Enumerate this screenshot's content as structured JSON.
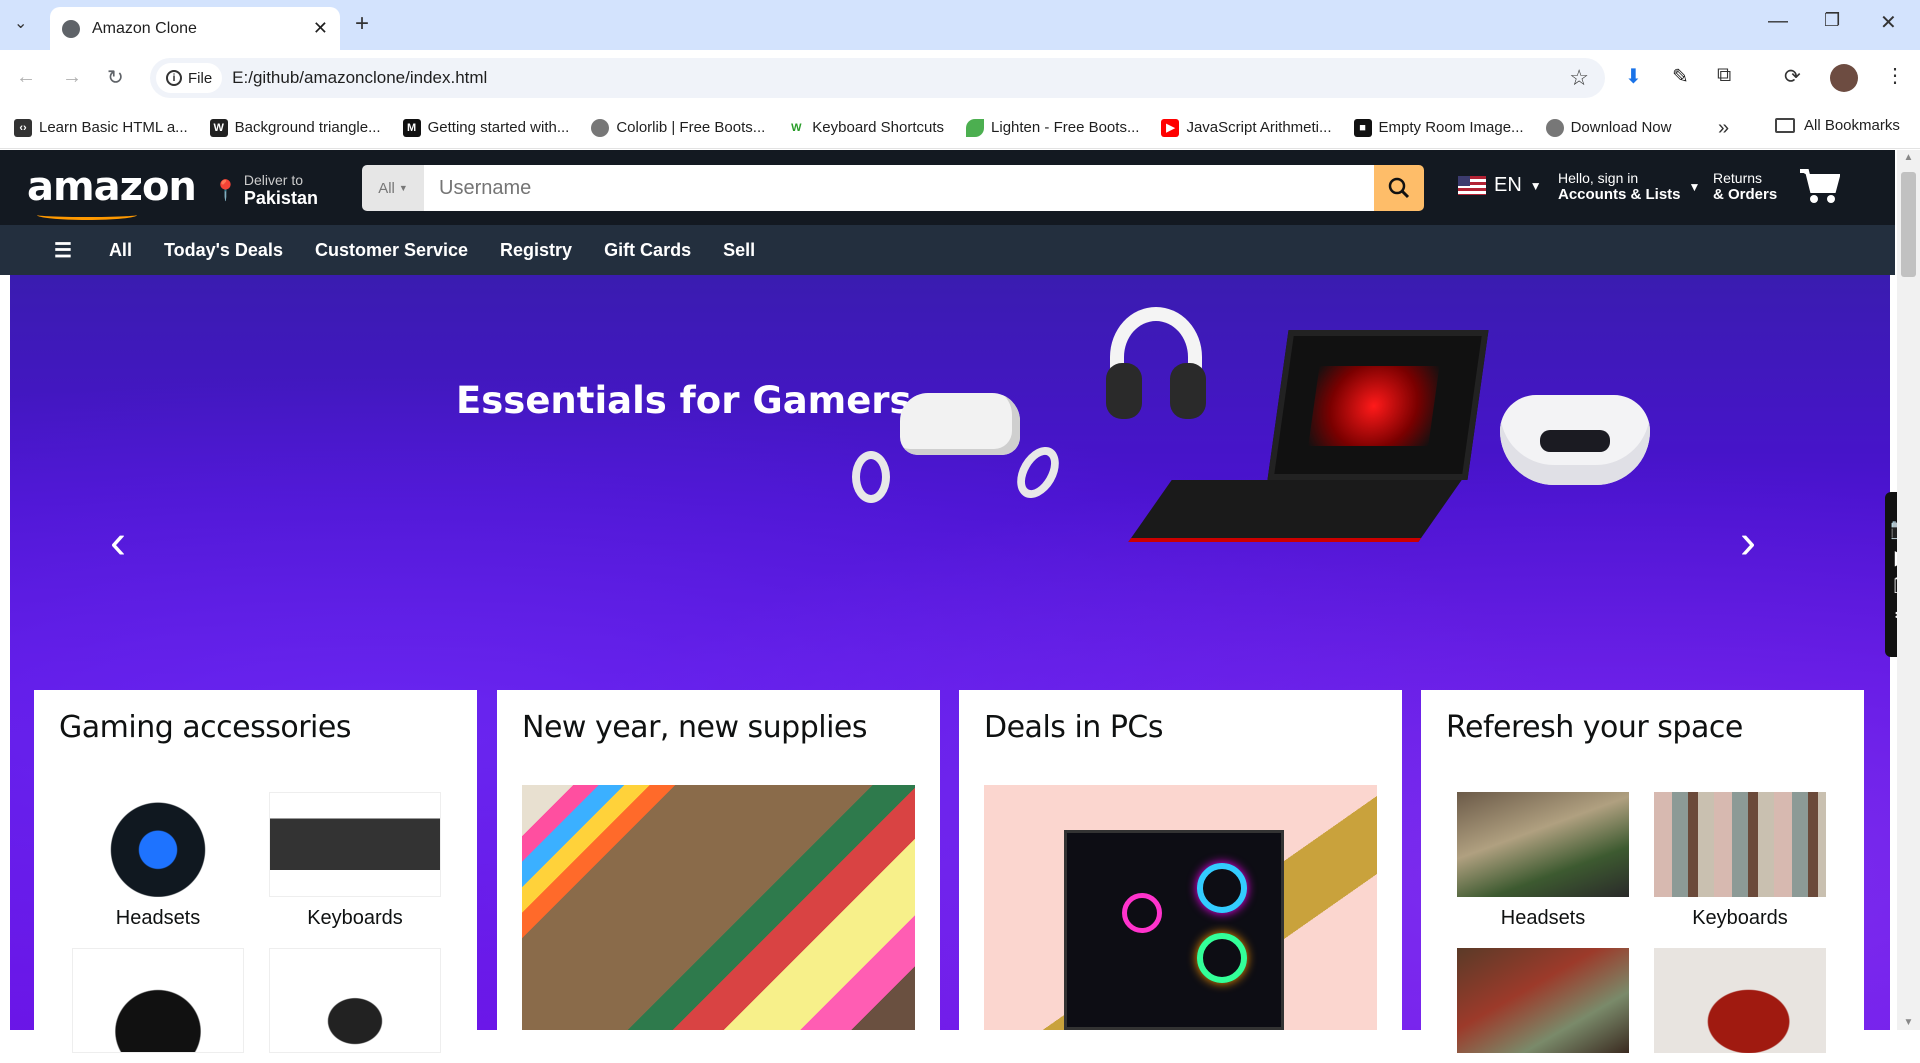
{
  "browser": {
    "tab_title": "Amazon Clone",
    "address_scheme": "File",
    "address_url": "E:/github/amazonclone/index.html",
    "bookmarks": [
      {
        "label": "Learn Basic HTML a...",
        "icon": "code-icon"
      },
      {
        "label": "Background triangle...",
        "icon": "w-icon"
      },
      {
        "label": "Getting started with...",
        "icon": "m-icon"
      },
      {
        "label": "Colorlib | Free Boots...",
        "icon": "globe-icon"
      },
      {
        "label": "Keyboard Shortcuts",
        "icon": "w-icon"
      },
      {
        "label": "Lighten - Free Boots...",
        "icon": "leaf-icon"
      },
      {
        "label": "JavaScript Arithmeti...",
        "icon": "youtube-icon"
      },
      {
        "label": "Empty Room Image...",
        "icon": "square-icon"
      },
      {
        "label": "Download Now",
        "icon": "globe-icon"
      }
    ],
    "all_bookmarks": "All Bookmarks"
  },
  "header": {
    "logo": "amazon",
    "deliver_line1": "Deliver to",
    "deliver_line2": "Pakistan",
    "search_category": "All",
    "search_placeholder": "Username",
    "language": "EN",
    "account_line1": "Hello, sign in",
    "account_line2": "Accounts & Lists",
    "returns_line1": "Returns",
    "returns_line2": "& Orders"
  },
  "nav": {
    "all": "All",
    "items": [
      "Today's Deals",
      "Customer Service",
      "Registry",
      "Gift Cards",
      "Sell"
    ]
  },
  "hero": {
    "title": "Essentials for Gamers"
  },
  "cards": [
    {
      "title": "Gaming accessories",
      "tiles": [
        "Headsets",
        "Keyboards"
      ]
    },
    {
      "title": "New year, new supplies"
    },
    {
      "title": "Deals in PCs"
    },
    {
      "title": "Referesh your space",
      "tiles": [
        "Headsets",
        "Keyboards"
      ]
    }
  ],
  "colors": {
    "nav_dark": "#131921",
    "nav_sub": "#232f3e",
    "search_btn": "#febd69",
    "hero": "#4a12d0"
  }
}
